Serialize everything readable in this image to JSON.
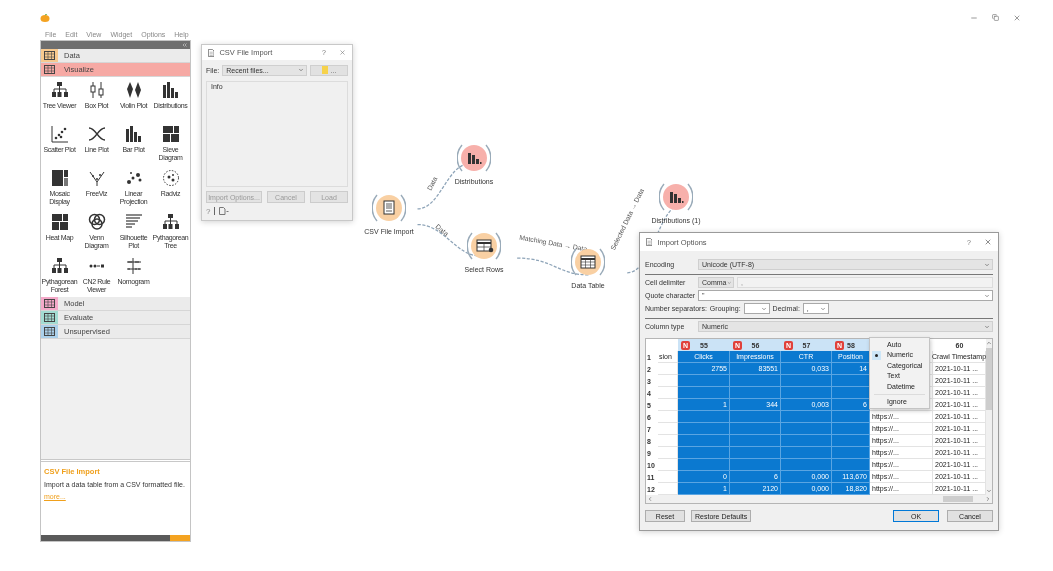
{
  "menu": [
    "File",
    "Edit",
    "View",
    "Widget",
    "Options",
    "Help"
  ],
  "toolbox": {
    "categories": [
      {
        "label": "Data",
        "color": "#f7c98f",
        "expanded": false
      },
      {
        "label": "Visualize",
        "color": "#f6a9a4",
        "expanded": true,
        "widgets": [
          {
            "label": "Tree Viewer"
          },
          {
            "label": "Box Plot"
          },
          {
            "label": "Violin Plot"
          },
          {
            "label": "Distributions"
          },
          {
            "label": "Scatter Plot"
          },
          {
            "label": "Line Plot"
          },
          {
            "label": "Bar Plot"
          },
          {
            "label": "Sieve Diagram"
          },
          {
            "label": "Mosaic Display"
          },
          {
            "label": "FreeViz"
          },
          {
            "label": "Linear Projection"
          },
          {
            "label": "Radviz"
          },
          {
            "label": "Heat Map"
          },
          {
            "label": "Venn Diagram"
          },
          {
            "label": "Silhouette Plot"
          },
          {
            "label": "Pythagorean Tree"
          },
          {
            "label": "Pythagorean Forest"
          },
          {
            "label": "CN2 Rule Viewer"
          },
          {
            "label": "Nomogram"
          }
        ]
      },
      {
        "label": "Model",
        "color": "#f4a9c9",
        "expanded": false
      },
      {
        "label": "Evaluate",
        "color": "#a3dcd2",
        "expanded": false
      },
      {
        "label": "Unsupervised",
        "color": "#abd0ea",
        "expanded": false
      }
    ]
  },
  "description": {
    "title": "CSV File Import",
    "text": "Import a data table from a CSV formatted file.",
    "link": "more..."
  },
  "csv_window": {
    "title": "CSV File Import",
    "help": "?",
    "file_label": "File:",
    "file_value": "Recent files...",
    "browse": "...",
    "info_label": "Info",
    "buttons": [
      {
        "label": "Import Options...",
        "disabled": true
      },
      {
        "label": "Cancel",
        "disabled": true
      },
      {
        "label": "Load",
        "disabled": true
      }
    ],
    "footer_help": "?"
  },
  "canvas": {
    "nodes": [
      {
        "label": "CSV File Import",
        "kind": "file",
        "color": "#f9d0a3"
      },
      {
        "label": "Distributions",
        "kind": "chart",
        "color": "#f7b0ab"
      },
      {
        "label": "Select Rows",
        "kind": "select",
        "color": "#f9d0a3"
      },
      {
        "label": "Data Table",
        "kind": "table",
        "color": "#f9d0a3"
      },
      {
        "label": "Distributions (1)",
        "kind": "chart",
        "color": "#f7b0ab"
      }
    ],
    "links": [
      {
        "label": "Data"
      },
      {
        "label": "Data"
      },
      {
        "label": "Matching Data → Data"
      },
      {
        "label": "Selected Data → Data"
      }
    ]
  },
  "import_options": {
    "title": "Import Options",
    "help": "?",
    "encoding": {
      "label": "Encoding",
      "value": "Unicode (UTF-8)"
    },
    "cell_delimiter": {
      "label": "Cell delimiter",
      "value": "Comma",
      "custom": ","
    },
    "quote_character": {
      "label": "Quote character",
      "value": "\""
    },
    "number_separators": {
      "label": "Number separators:",
      "grouping_label": "Grouping:",
      "decimal_label": "Decimal:",
      "decimal": ","
    },
    "column_type": {
      "label": "Column type",
      "value": "Numeric"
    },
    "table": {
      "name_row": "1",
      "columns": [
        {
          "name": "sion",
          "selected": false
        },
        {
          "number": "55",
          "badge": "N",
          "name": "Clicks",
          "selected": true
        },
        {
          "number": "56",
          "badge": "N",
          "name": "Impressions",
          "selected": true
        },
        {
          "number": "57",
          "badge": "N",
          "name": "CTR",
          "selected": true
        },
        {
          "number": "58",
          "badge": "N",
          "name": "Position",
          "selected": true
        },
        {
          "selected": false
        },
        {
          "number": "60",
          "name": "Crawl Timestamp",
          "selected": false
        }
      ],
      "rows": [
        {
          "number": "2",
          "cells": [
            null,
            "2755",
            "83551",
            "0,033",
            "14",
            null,
            "2021-10-11 ..."
          ]
        },
        {
          "number": "3",
          "cells": [
            null,
            null,
            null,
            null,
            null,
            null,
            "2021-10-11 ..."
          ]
        },
        {
          "number": "4",
          "cells": [
            null,
            null,
            null,
            null,
            null,
            null,
            "2021-10-11 ..."
          ]
        },
        {
          "number": "5",
          "cells": [
            null,
            "1",
            "344",
            "0,003",
            "6",
            null,
            "2021-10-11 ..."
          ]
        },
        {
          "number": "6",
          "cells": [
            null,
            null,
            null,
            null,
            null,
            "https://...",
            "2021-10-11 ..."
          ]
        },
        {
          "number": "7",
          "cells": [
            null,
            null,
            null,
            null,
            null,
            "https://...",
            "2021-10-11 ..."
          ]
        },
        {
          "number": "8",
          "cells": [
            null,
            null,
            null,
            null,
            null,
            "https://...",
            "2021-10-11 ..."
          ]
        },
        {
          "number": "9",
          "cells": [
            null,
            null,
            null,
            null,
            null,
            "https://...",
            "2021-10-11 ..."
          ]
        },
        {
          "number": "10",
          "cells": [
            null,
            null,
            null,
            null,
            null,
            "https://...",
            "2021-10-11 ..."
          ]
        },
        {
          "number": "11",
          "cells": [
            null,
            "0",
            "6",
            "0,000",
            "113,670",
            "https://...",
            "2021-10-11 ..."
          ]
        },
        {
          "number": "12",
          "cells": [
            null,
            "1",
            "2120",
            "0,000",
            "18,820",
            "https://...",
            "2021-10-11 ..."
          ]
        }
      ]
    },
    "column_menu": [
      {
        "kind": "option",
        "label": "Auto",
        "selected": false
      },
      {
        "kind": "option",
        "label": "Numeric",
        "selected": true
      },
      {
        "kind": "option",
        "label": "Categorical",
        "selected": false
      },
      {
        "kind": "option",
        "label": "Text",
        "selected": false
      },
      {
        "kind": "option",
        "label": "Datetime",
        "selected": false
      },
      {
        "kind": "separator"
      },
      {
        "kind": "option",
        "label": "Ignore",
        "selected": false
      }
    ],
    "buttons_left": [
      {
        "label": "Reset",
        "default": false
      },
      {
        "label": "Restore Defaults",
        "default": false
      }
    ],
    "buttons_right": [
      {
        "label": "OK",
        "default": true
      },
      {
        "label": "Cancel",
        "default": false
      }
    ]
  }
}
